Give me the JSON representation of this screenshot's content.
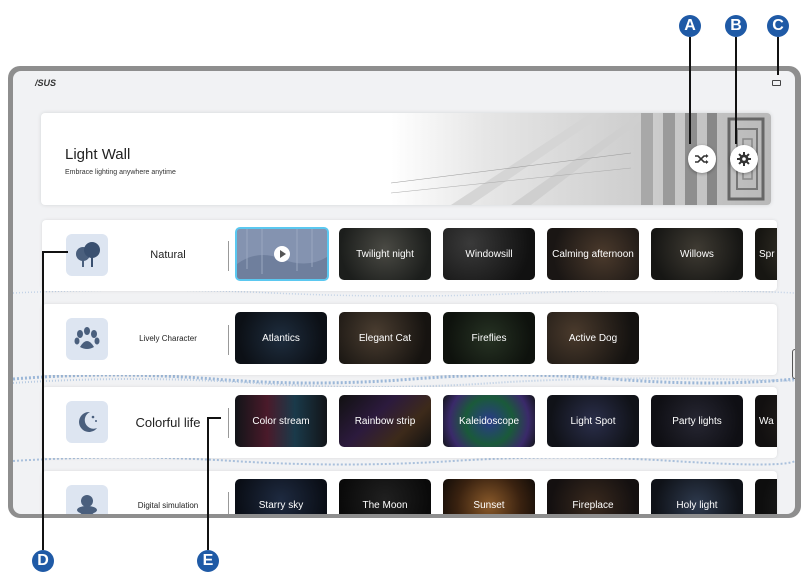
{
  "callouts": {
    "a": "A",
    "b": "B",
    "c": "C",
    "d": "D",
    "e": "E"
  },
  "device": {
    "brand": "/SUS"
  },
  "header": {
    "title": "Light Wall",
    "subtitle": "Embrace lighting anywhere anytime"
  },
  "icons": {
    "shuffle": "shuffle-icon",
    "settings": "gear-icon",
    "natural": "trees-icon",
    "lively": "paw-icon",
    "colorful": "moon-stars-icon",
    "digital": "stacked-shapes-icon",
    "play": "play-icon",
    "camera": "camera-icon"
  },
  "accent_color": "#1f5aa6",
  "selection_color": "#5bc8f0",
  "categories": [
    {
      "label": "Natural",
      "tiles": [
        "",
        "Twilight night",
        "Windowsill",
        "Calming afternoon",
        "Willows",
        "Spr"
      ]
    },
    {
      "label": "Lively Character",
      "tiles": [
        "Atlantics",
        "Elegant Cat",
        "Fireflies",
        "Active Dog"
      ]
    },
    {
      "label": "Colorful life",
      "tiles": [
        "Color stream",
        "Rainbow strip",
        "Kaleidoscope",
        "Light Spot",
        "Party lights",
        "Wa"
      ]
    },
    {
      "label": "Digital simulation",
      "tiles": [
        "Starry sky",
        "The Moon",
        "Sunset",
        "Fireplace",
        "Holy light",
        "F"
      ]
    }
  ]
}
